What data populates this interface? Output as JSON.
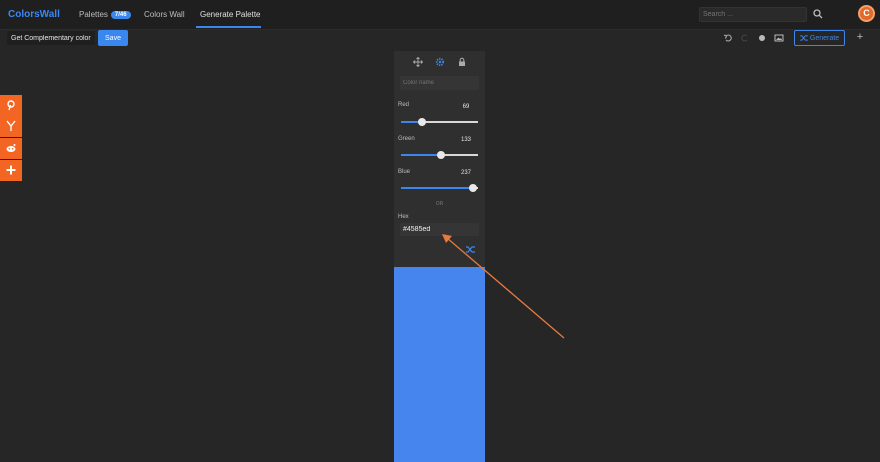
{
  "brand": "ColorsWall",
  "nav": {
    "palettes": "Palettes",
    "palettes_badge": "7/46",
    "colors_wall": "Colors Wall",
    "generate_palette": "Generate Palette"
  },
  "search": {
    "placeholder": "Search ..."
  },
  "avatar_letter": "C",
  "toolbar": {
    "title_value": "Get Complementary color",
    "save_label": "Save",
    "generate_label": "Generate",
    "add_label": "+"
  },
  "share_icons": [
    "pinterest-icon",
    "y-combinator-icon",
    "reddit-icon",
    "add-icon"
  ],
  "column": {
    "name_placeholder": "Color name",
    "channels": [
      {
        "label": "Red",
        "value": "69",
        "level": 69
      },
      {
        "label": "Green",
        "value": "133",
        "level": 133
      },
      {
        "label": "Blue",
        "value": "237",
        "level": 237
      }
    ],
    "channel_max": 255,
    "or_text": "OR",
    "hex_label": "Hex",
    "hex_value": "#4585ed",
    "swatch_color": "#4585ed"
  },
  "colors": {
    "accent": "#3b87f0",
    "share_bar": "#f26522",
    "arrow": "#e87a3c",
    "background": "#262626"
  }
}
